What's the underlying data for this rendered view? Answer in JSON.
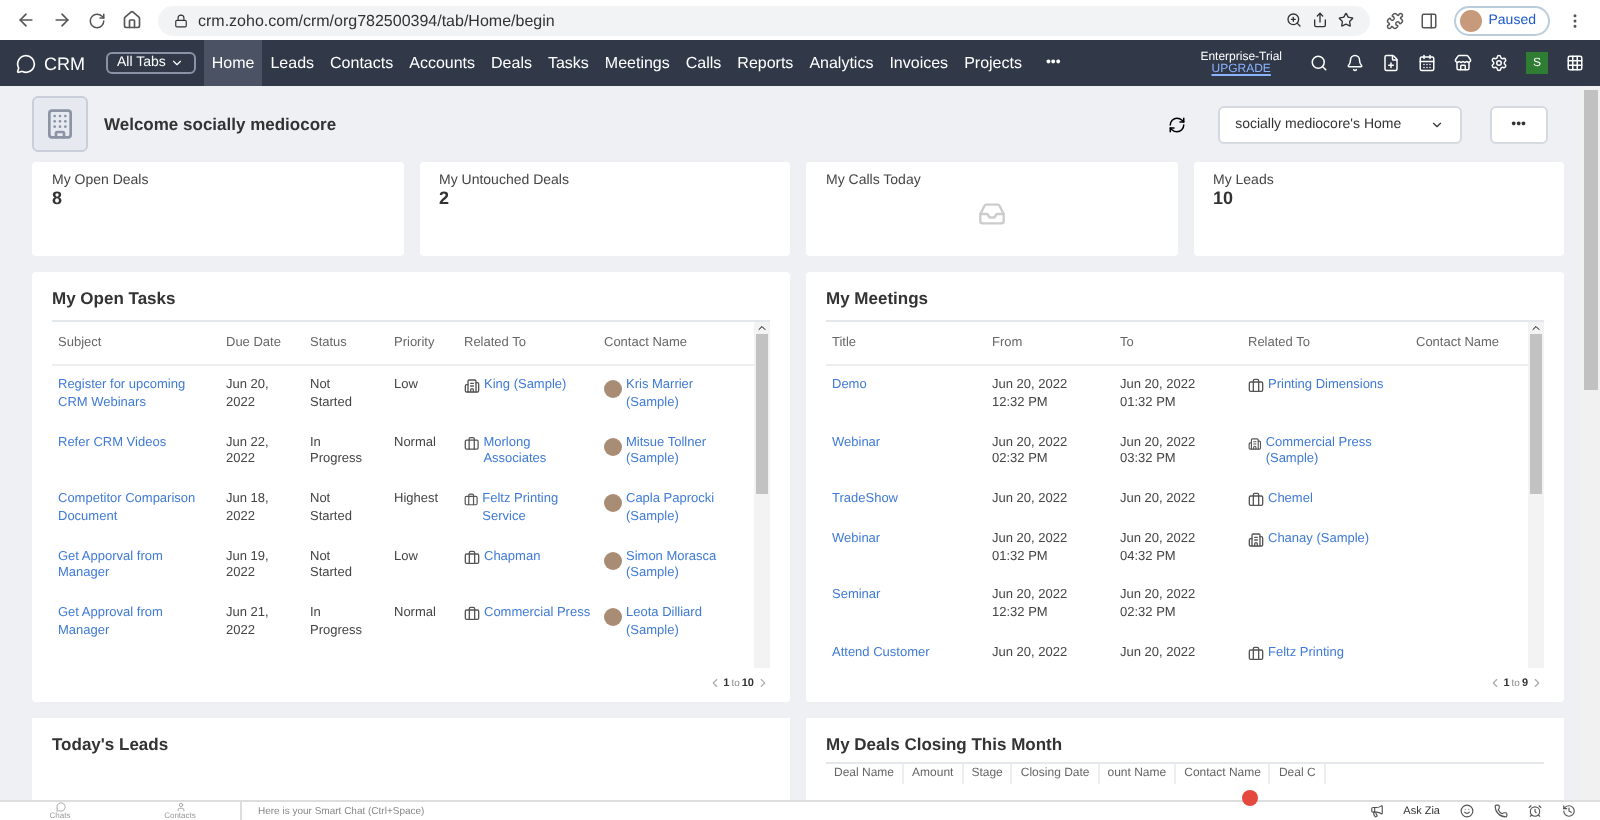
{
  "browser": {
    "url": "crm.zoho.com/crm/org782500394/tab/Home/begin",
    "profile": "Paused"
  },
  "nav": {
    "logo": "CRM",
    "all_tabs": "All Tabs",
    "tabs": [
      {
        "label": "Home",
        "selected": true
      },
      {
        "label": "Leads",
        "selected": false
      },
      {
        "label": "Contacts",
        "selected": false
      },
      {
        "label": "Accounts",
        "selected": false
      },
      {
        "label": "Deals",
        "selected": false
      },
      {
        "label": "Tasks",
        "selected": false
      },
      {
        "label": "Meetings",
        "selected": false
      },
      {
        "label": "Calls",
        "selected": false
      },
      {
        "label": "Reports",
        "selected": false
      },
      {
        "label": "Analytics",
        "selected": false
      },
      {
        "label": "Invoices",
        "selected": false
      },
      {
        "label": "Projects",
        "selected": false
      }
    ],
    "more": "•••",
    "plan": "Enterprise-Trial",
    "upgrade": "UPGRADE",
    "user_initial": "S"
  },
  "welcome": {
    "title": "Welcome socially mediocore",
    "home_select": "socially mediocore's Home",
    "more": "•••"
  },
  "stats": [
    {
      "label": "My Open Deals",
      "value": "8"
    },
    {
      "label": "My Untouched Deals",
      "value": "2"
    },
    {
      "label": "My Calls Today"
    },
    {
      "label": "My Leads",
      "value": "10"
    }
  ],
  "tasks": {
    "title": "My Open Tasks",
    "columns": [
      "Subject",
      "Due Date",
      "Status",
      "Priority",
      "Related To",
      "Contact Name"
    ],
    "rows": [
      {
        "subject": "Register for upcoming CRM Webinars",
        "due": "Jun 20, 2022",
        "status": "Not Started",
        "priority": "Low",
        "related": {
          "kind": "building",
          "name": "King (Sample)"
        },
        "contact": "Kris Marrier (Sample)"
      },
      {
        "subject": "Refer CRM Videos",
        "due": "Jun 22, 2022",
        "status": "In Progress",
        "priority": "Normal",
        "related": {
          "kind": "briefcase",
          "name": "Morlong Associates"
        },
        "contact": "Mitsue Tollner (Sample)"
      },
      {
        "subject": "Competitor Comparison Document",
        "due": "Jun 18, 2022",
        "status": "Not Started",
        "priority": "Highest",
        "related": {
          "kind": "briefcase",
          "name": "Feltz Printing Service"
        },
        "contact": "Capla Paprocki (Sample)"
      },
      {
        "subject": "Get Apporval from Manager",
        "due": "Jun 19, 2022",
        "status": "Not Started",
        "priority": "Low",
        "related": {
          "kind": "briefcase",
          "name": "Chapman"
        },
        "contact": "Simon Morasca (Sample)"
      },
      {
        "subject": "Get Approval from Manager",
        "due": "Jun 21, 2022",
        "status": "In Progress",
        "priority": "Normal",
        "related": {
          "kind": "briefcase",
          "name": "Commercial Press"
        },
        "contact": "Leota Dilliard (Sample)"
      }
    ],
    "pager": {
      "from": "1",
      "sep": "to",
      "to": "10"
    }
  },
  "meetings": {
    "title": "My Meetings",
    "columns": [
      "Title",
      "From",
      "To",
      "Related To",
      "Contact Name"
    ],
    "rows": [
      {
        "title": "Demo",
        "from": "Jun 20, 2022 12:32 PM",
        "to": "Jun 20, 2022 01:32 PM",
        "related": {
          "kind": "briefcase",
          "name": "Printing Dimensions"
        }
      },
      {
        "title": "Webinar",
        "from": "Jun 20, 2022 02:32 PM",
        "to": "Jun 20, 2022 03:32 PM",
        "related": {
          "kind": "building",
          "name": "Commercial Press (Sample)"
        }
      },
      {
        "title": "TradeShow",
        "from": "Jun 20, 2022",
        "to": "Jun 20, 2022",
        "related": {
          "kind": "briefcase",
          "name": "Chemel"
        }
      },
      {
        "title": "Webinar",
        "from": "Jun 20, 2022 01:32 PM",
        "to": "Jun 20, 2022 04:32 PM",
        "related": {
          "kind": "building",
          "name": "Chanay (Sample)"
        }
      },
      {
        "title": "Seminar",
        "from": "Jun 20, 2022 12:32 PM",
        "to": "Jun 20, 2022 02:32 PM",
        "related": null
      },
      {
        "title": "Attend Customer",
        "from": "Jun 20, 2022",
        "to": "Jun 20, 2022",
        "related": {
          "kind": "briefcase",
          "name": "Feltz Printing"
        }
      }
    ],
    "pager": {
      "from": "1",
      "sep": "to",
      "to": "9"
    }
  },
  "leads": {
    "title": "Today's Leads"
  },
  "deals": {
    "title": "My Deals Closing This Month",
    "columns": [
      "Deal Name",
      "Amount",
      "Stage",
      "Closing Date",
      "ount Name",
      "Contact Name",
      "Deal C"
    ]
  },
  "bottom_bar": {
    "chats": "Chats",
    "contacts": "Contacts",
    "smart_chat": "Here is your Smart Chat (Ctrl+Space)",
    "ask_zia": "Ask Zia"
  }
}
